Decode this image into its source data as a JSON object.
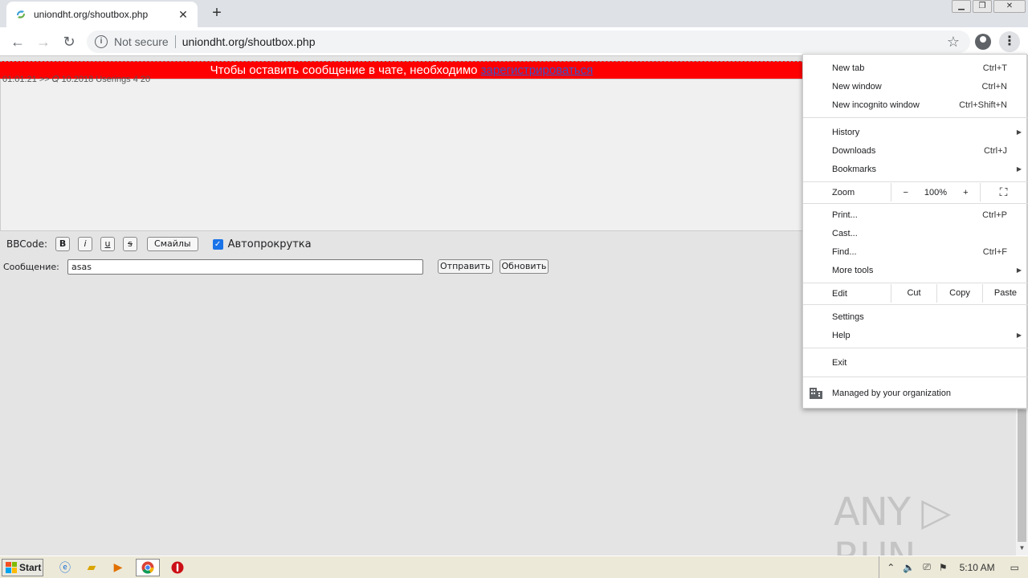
{
  "browser": {
    "tab_title": "uniondht.org/shoutbox.php",
    "tab_close": "✕",
    "new_tab": "+",
    "not_secure": "Not secure",
    "url": "uniondht.org/shoutbox.php",
    "win_minimize": "▁",
    "win_restore": "❐",
    "win_close": "✕"
  },
  "page": {
    "banner_text": "Чтобы оставить сообщение в чате, необходимо ",
    "banner_link": "зарегистрироваться",
    "chat_line": "01:01:21 >> 𝑄 10.2018                                        Userings 4 20",
    "bbcode_label": "BBCode:",
    "bb_bold": "B",
    "bb_italic": "i",
    "bb_underline": "u",
    "bb_strike": "s",
    "smileys_button": "Смайлы",
    "autoscroll_label": "Автопрокрутка",
    "message_label": "Сообщение:",
    "message_value": "asas",
    "send_button": "Отправить",
    "refresh_button": "Обновить"
  },
  "menu": {
    "new_tab": {
      "label": "New tab",
      "shortcut": "Ctrl+T"
    },
    "new_window": {
      "label": "New window",
      "shortcut": "Ctrl+N"
    },
    "new_incognito": {
      "label": "New incognito window",
      "shortcut": "Ctrl+Shift+N"
    },
    "history": {
      "label": "History"
    },
    "downloads": {
      "label": "Downloads",
      "shortcut": "Ctrl+J"
    },
    "bookmarks": {
      "label": "Bookmarks"
    },
    "zoom": {
      "label": "Zoom",
      "minus": "−",
      "value": "100%",
      "plus": "+"
    },
    "print": {
      "label": "Print...",
      "shortcut": "Ctrl+P"
    },
    "cast": {
      "label": "Cast..."
    },
    "find": {
      "label": "Find...",
      "shortcut": "Ctrl+F"
    },
    "more_tools": {
      "label": "More tools"
    },
    "edit": {
      "label": "Edit",
      "cut": "Cut",
      "copy": "Copy",
      "paste": "Paste"
    },
    "settings": {
      "label": "Settings"
    },
    "help": {
      "label": "Help"
    },
    "exit": {
      "label": "Exit"
    },
    "managed": {
      "label": "Managed by your organization"
    }
  },
  "watermark": "ANY ▷ RUN",
  "taskbar": {
    "start_label": "Start",
    "clock": "5:10 AM"
  },
  "colors": {
    "banner_bg": "#ff0000",
    "accent": "#1a73e8"
  }
}
